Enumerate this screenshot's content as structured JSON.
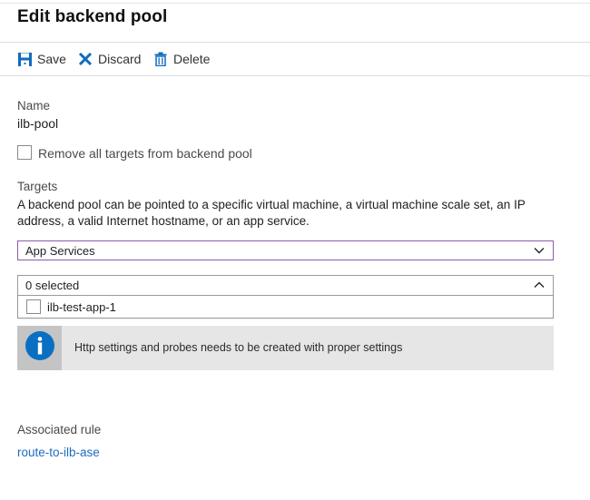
{
  "header": {
    "title": "Edit backend pool"
  },
  "toolbar": {
    "save_label": "Save",
    "discard_label": "Discard",
    "delete_label": "Delete"
  },
  "form": {
    "name_label": "Name",
    "name_value": "ilb-pool",
    "remove_targets_label": "Remove all targets from backend pool",
    "remove_targets_checked": false,
    "targets_label": "Targets",
    "targets_description": "A backend pool can be pointed to a specific virtual machine, a virtual machine scale set, an IP address, a valid Internet hostname, or an app service.",
    "target_type_selected": "App Services",
    "target_select_value": "0 selected",
    "target_options": [
      {
        "label": "ilb-test-app-1",
        "checked": false
      }
    ],
    "info_message": "Http settings and probes needs to be created with proper settings"
  },
  "associated": {
    "label": "Associated rule",
    "rule_link": "route-to-ilb-ase"
  },
  "colors": {
    "accent_blue": "#1f6dbf",
    "icon_blue": "#0f6cbd",
    "info_blue": "#0a6fc2",
    "dropdown_focus_border": "#8e5aa8",
    "info_background": "#e6e6e6"
  }
}
